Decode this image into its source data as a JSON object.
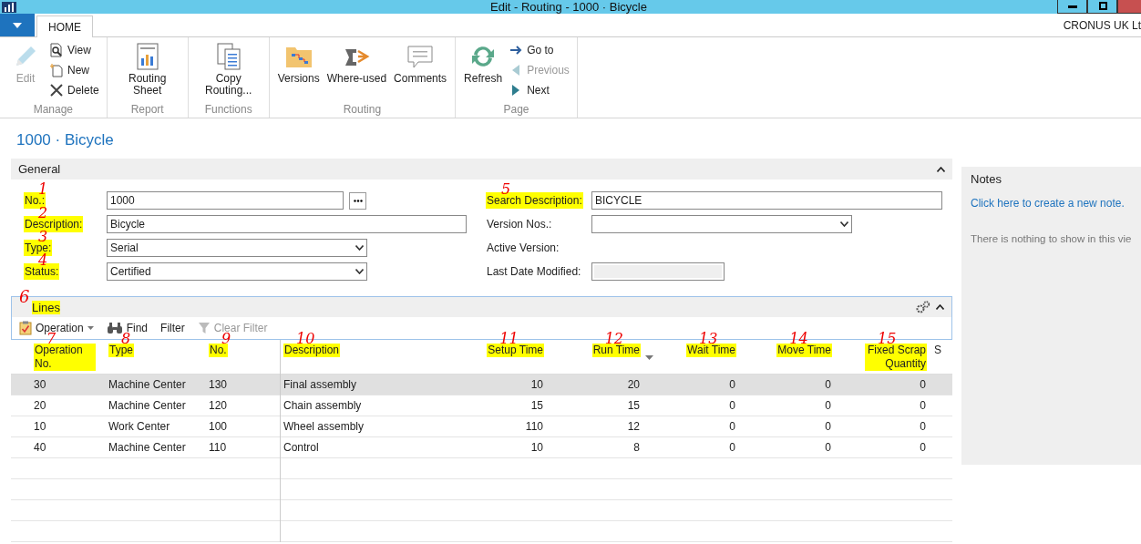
{
  "window": {
    "title": "Edit - Routing - 1000 · Bicycle"
  },
  "tabs": [
    {
      "label": "HOME",
      "selected": true
    }
  ],
  "company": "CRONUS UK Lt",
  "ribbon": [
    {
      "label": "Manage",
      "actions": [
        {
          "label": "Edit",
          "disabled": true
        },
        {
          "label": "View",
          "disabled": false
        },
        {
          "label": "New",
          "disabled": false
        },
        {
          "label": "Delete",
          "disabled": false
        }
      ]
    },
    {
      "label": "Report",
      "actions": [
        {
          "label": "Routing Sheet",
          "disabled": false
        }
      ]
    },
    {
      "label": "Functions",
      "actions": [
        {
          "label": "Copy Routing...",
          "disabled": false
        }
      ]
    },
    {
      "label": "Routing",
      "actions": [
        {
          "label": "Versions",
          "disabled": false
        },
        {
          "label": "Where-used",
          "disabled": false
        },
        {
          "label": "Comments",
          "disabled": false
        }
      ]
    },
    {
      "label": "Page",
      "actions": [
        {
          "label": "Refresh",
          "disabled": false
        },
        {
          "label": "Go to",
          "disabled": false
        },
        {
          "label": "Previous",
          "disabled": true
        },
        {
          "label": "Next",
          "disabled": false
        }
      ]
    }
  ],
  "page_title": "1000 · Bicycle",
  "general": {
    "title": "General",
    "expanded": true,
    "left_fields": [
      {
        "label": "No.:",
        "value": "1000",
        "kind": "text",
        "assist": true,
        "highlighted": true,
        "annotation": "1"
      },
      {
        "label": "Description:",
        "value": "Bicycle",
        "kind": "text",
        "assist": false,
        "highlighted": true,
        "annotation": "2"
      },
      {
        "label": "Type:",
        "value": "Serial",
        "kind": "select",
        "assist": false,
        "highlighted": true,
        "annotation": "3"
      },
      {
        "label": "Status:",
        "value": "Certified",
        "kind": "select",
        "assist": false,
        "highlighted": true,
        "annotation": "4"
      }
    ],
    "right_fields": [
      {
        "label": "Search Description:",
        "value": "BICYCLE",
        "kind": "text",
        "highlighted": true,
        "annotation": "5"
      },
      {
        "label": "Version Nos.:",
        "kind": "select",
        "highlighted": false
      },
      {
        "label": "Active Version:",
        "kind": "static",
        "highlighted": false
      },
      {
        "label": "Last Date Modified:",
        "kind": "readonly",
        "highlighted": false
      }
    ]
  },
  "lines": {
    "title": "Lines",
    "expanded": true,
    "highlighted": true,
    "annotation": "6",
    "toolbar": [
      {
        "label": "Operation",
        "dropdown": true,
        "disabled": false
      },
      {
        "label": "Find",
        "dropdown": false,
        "disabled": false
      },
      {
        "label": "Filter",
        "dropdown": false,
        "disabled": false
      },
      {
        "label": "Clear Filter",
        "dropdown": false,
        "disabled": true
      }
    ],
    "columns": [
      {
        "label": "Operation No.",
        "highlighted": true,
        "annotation": "7",
        "sorted": false
      },
      {
        "label": "Type",
        "highlighted": true,
        "annotation": "8",
        "sorted": false
      },
      {
        "label": "No.",
        "highlighted": true,
        "annotation": "9",
        "sorted": false
      },
      {
        "label": "Description",
        "highlighted": true,
        "annotation": "10",
        "sorted": false
      },
      {
        "label": "Setup Time",
        "highlighted": true,
        "annotation": "11",
        "sorted": false
      },
      {
        "label": "Run Time",
        "highlighted": true,
        "annotation": "12",
        "sorted": true
      },
      {
        "label": "Wait Time",
        "highlighted": true,
        "annotation": "13",
        "sorted": false
      },
      {
        "label": "Move Time",
        "highlighted": true,
        "annotation": "14",
        "sorted": false
      },
      {
        "label": "Fixed Scrap Quantity",
        "highlighted": true,
        "annotation": "15",
        "sorted": false
      },
      {
        "label": "S",
        "highlighted": false,
        "sorted": false
      }
    ],
    "rows": [
      {
        "selected": true,
        "cells": [
          "30",
          "Machine Center",
          "130",
          "Final assembly",
          "10",
          "20",
          "0",
          "0",
          "0"
        ]
      },
      {
        "selected": false,
        "cells": [
          "20",
          "Machine Center",
          "120",
          "Chain assembly",
          "15",
          "15",
          "0",
          "0",
          "0"
        ]
      },
      {
        "selected": false,
        "cells": [
          "10",
          "Work Center",
          "100",
          "Wheel assembly",
          "110",
          "12",
          "0",
          "0",
          "0"
        ]
      },
      {
        "selected": false,
        "cells": [
          "40",
          "Machine Center",
          "110",
          "Control",
          "10",
          "8",
          "0",
          "0",
          "0"
        ]
      }
    ]
  },
  "notes": {
    "title": "Notes",
    "link": "Click here to create a new note.",
    "empty_text": "There is nothing to show in this vie"
  }
}
